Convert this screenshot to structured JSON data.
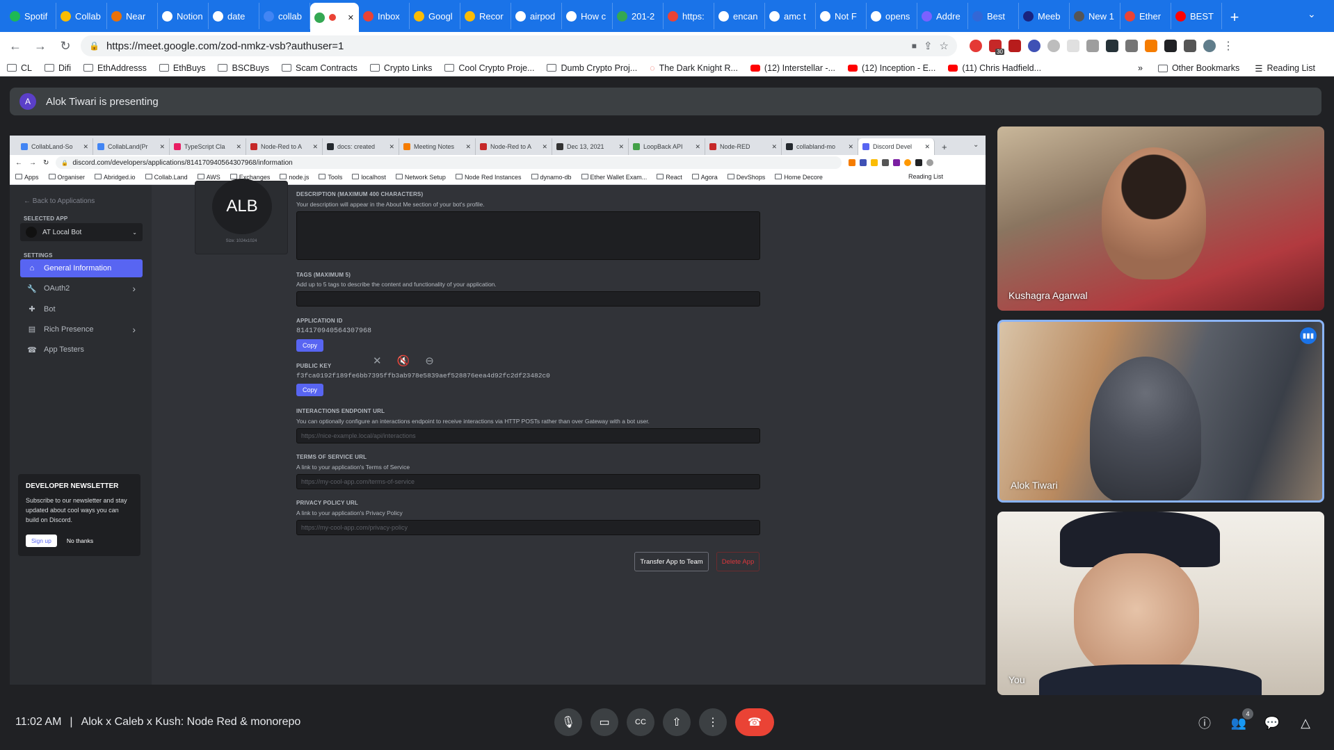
{
  "browser": {
    "tabs": [
      {
        "title": "Spotif",
        "color": "#1db954"
      },
      {
        "title": "Collab",
        "color": "#fbbc04"
      },
      {
        "title": "Near",
        "color": "#e8710a"
      },
      {
        "title": "Notion",
        "color": "#ffffff"
      },
      {
        "title": "date",
        "color": "#ffffff"
      },
      {
        "title": "collab",
        "color": "#4285f4"
      },
      {
        "title": "",
        "color": "#34a853",
        "active": true
      },
      {
        "title": "Inbox",
        "color": "#ea4335"
      },
      {
        "title": "Googl",
        "color": "#fbbc04"
      },
      {
        "title": "Recor",
        "color": "#fbbc04"
      },
      {
        "title": "airpod",
        "color": "#ffffff"
      },
      {
        "title": "How c",
        "color": "#ffffff"
      },
      {
        "title": "201-2",
        "color": "#34a853"
      },
      {
        "title": "https:",
        "color": "#ea4335"
      },
      {
        "title": "encan",
        "color": "#ffffff"
      },
      {
        "title": "amc t",
        "color": "#ffffff"
      },
      {
        "title": "Not F",
        "color": "#ffffff"
      },
      {
        "title": "opens",
        "color": "#ffffff"
      },
      {
        "title": "Addre",
        "color": "#7b61ff"
      },
      {
        "title": "Best",
        "color": "#3367d6"
      },
      {
        "title": "Meeb",
        "color": "#1a237e"
      },
      {
        "title": "New 1",
        "color": "#555555"
      },
      {
        "title": "Ether",
        "color": "#ea4335"
      },
      {
        "title": "BEST",
        "color": "#ff0000"
      }
    ],
    "url": "https://meet.google.com/zod-nmkz-vsb?authuser=1",
    "bookmarks": [
      {
        "label": "CL",
        "type": "folder"
      },
      {
        "label": "Difi",
        "type": "folder"
      },
      {
        "label": "EthAddresss",
        "type": "folder"
      },
      {
        "label": "EthBuys",
        "type": "folder"
      },
      {
        "label": "BSCBuys",
        "type": "folder"
      },
      {
        "label": "Scam Contracts",
        "type": "folder"
      },
      {
        "label": "Crypto Links",
        "type": "folder"
      },
      {
        "label": "Cool Crypto Proje...",
        "type": "folder"
      },
      {
        "label": "Dumb Crypto Proj...",
        "type": "folder"
      },
      {
        "label": "The Dark Knight R...",
        "type": "link"
      },
      {
        "label": "(12) Interstellar -...",
        "type": "youtube"
      },
      {
        "label": "(12) Inception - E...",
        "type": "youtube"
      },
      {
        "label": "(11) Chris Hadfield...",
        "type": "youtube"
      }
    ],
    "bookmarks_overflow": "»",
    "other_bookmarks": "Other Bookmarks",
    "reading_list": "Reading List",
    "badge_30": "30"
  },
  "meet": {
    "presenting_initial": "A",
    "presenting_text": "Alok Tiwari is presenting",
    "time": "11:02 AM",
    "separator": "|",
    "meeting_title": "Alok x Caleb x Kush: Node Red & monorepo",
    "participants_count": "4",
    "participants": [
      {
        "name": "Kushagra Agarwal"
      },
      {
        "name": "Alok Tiwari",
        "speaking": true
      },
      {
        "name": "You"
      }
    ]
  },
  "shared": {
    "tabs": [
      {
        "title": "CollabLand-So",
        "color": "#4285f4"
      },
      {
        "title": "CollabLand(Pr",
        "color": "#4285f4"
      },
      {
        "title": "TypeScript Cla",
        "color": "#e91e63"
      },
      {
        "title": "Node-Red to A",
        "color": "#c62828"
      },
      {
        "title": "docs: created",
        "color": "#24292e"
      },
      {
        "title": "Meeting Notes",
        "color": "#f57c00"
      },
      {
        "title": "Node-Red to A",
        "color": "#c62828"
      },
      {
        "title": "Dec 13, 2021",
        "color": "#333333"
      },
      {
        "title": "LoopBack API",
        "color": "#43a047"
      },
      {
        "title": "Node-RED",
        "color": "#c62828"
      },
      {
        "title": "collabland-mo",
        "color": "#24292e"
      },
      {
        "title": "Discord Devel",
        "color": "#5865f2",
        "active": true
      }
    ],
    "url": "discord.com/developers/applications/814170940564307968/information",
    "bookmarks": [
      "Apps",
      "Organiser",
      "Abridged.io",
      "Collab.Land",
      "AWS",
      "Exchanges",
      "node.js",
      "Tools",
      "localhost",
      "Network Setup",
      "Node Red Instances",
      "dynamo-db",
      "Ether Wallet Exam...",
      "React",
      "Agora",
      "DevShops",
      "Home Decore"
    ],
    "reading_list": "Reading List"
  },
  "discord": {
    "back": "← Back to Applications",
    "selected_app_label": "SELECTED APP",
    "selected_app": "AT Local Bot",
    "settings_label": "SETTINGS",
    "nav": [
      {
        "label": "General Information",
        "icon": "home-icon",
        "selected": true
      },
      {
        "label": "OAuth2",
        "icon": "wrench-icon",
        "chevron": true
      },
      {
        "label": "Bot",
        "icon": "puzzle-icon"
      },
      {
        "label": "Rich Presence",
        "icon": "doc-icon",
        "chevron": true
      },
      {
        "label": "App Testers",
        "icon": "phone-icon"
      }
    ],
    "newsletter": {
      "title": "DEVELOPER NEWSLETTER",
      "body": "Subscribe to our newsletter and stay updated about cool ways you can build on Discord.",
      "signup": "Sign up",
      "no_thanks": "No thanks"
    },
    "app_icon_text": "ALB",
    "app_icon_size": "Size: 1024x1024",
    "description_label": "DESCRIPTION (MAXIMUM 400 CHARACTERS)",
    "description_help": "Your description will appear in the About Me section of your bot's profile.",
    "tags_label": "TAGS (MAXIMUM 5)",
    "tags_help": "Add up to 5 tags to describe the content and functionality of your application.",
    "appid_label": "APPLICATION ID",
    "appid": "814170940564307968",
    "copy": "Copy",
    "pubkey_label": "PUBLIC KEY",
    "pubkey": "f3fca0192f189fe6bb7395ffb3ab978e5839aef528876eea4d92fc2df23482c0",
    "endpoint_label": "INTERACTIONS ENDPOINT URL",
    "endpoint_help": "You can optionally configure an interactions endpoint to receive interactions via HTTP POSTs rather than over Gateway with a bot user.",
    "endpoint_placeholder": "https://nice-example.local/api/interactions",
    "tos_label": "TERMS OF SERVICE URL",
    "tos_help": "A link to your application's Terms of Service",
    "tos_placeholder": "https://my-cool-app.com/terms-of-service",
    "privacy_label": "PRIVACY POLICY URL",
    "privacy_help": "A link to your application's Privacy Policy",
    "privacy_placeholder": "https://my-cool-app.com/privacy-policy",
    "transfer": "Transfer App to Team",
    "delete": "Delete App"
  },
  "colors": {
    "meet_red": "#ea4335",
    "blurple": "#5865f2",
    "chrome_blue": "#1a73e8"
  }
}
